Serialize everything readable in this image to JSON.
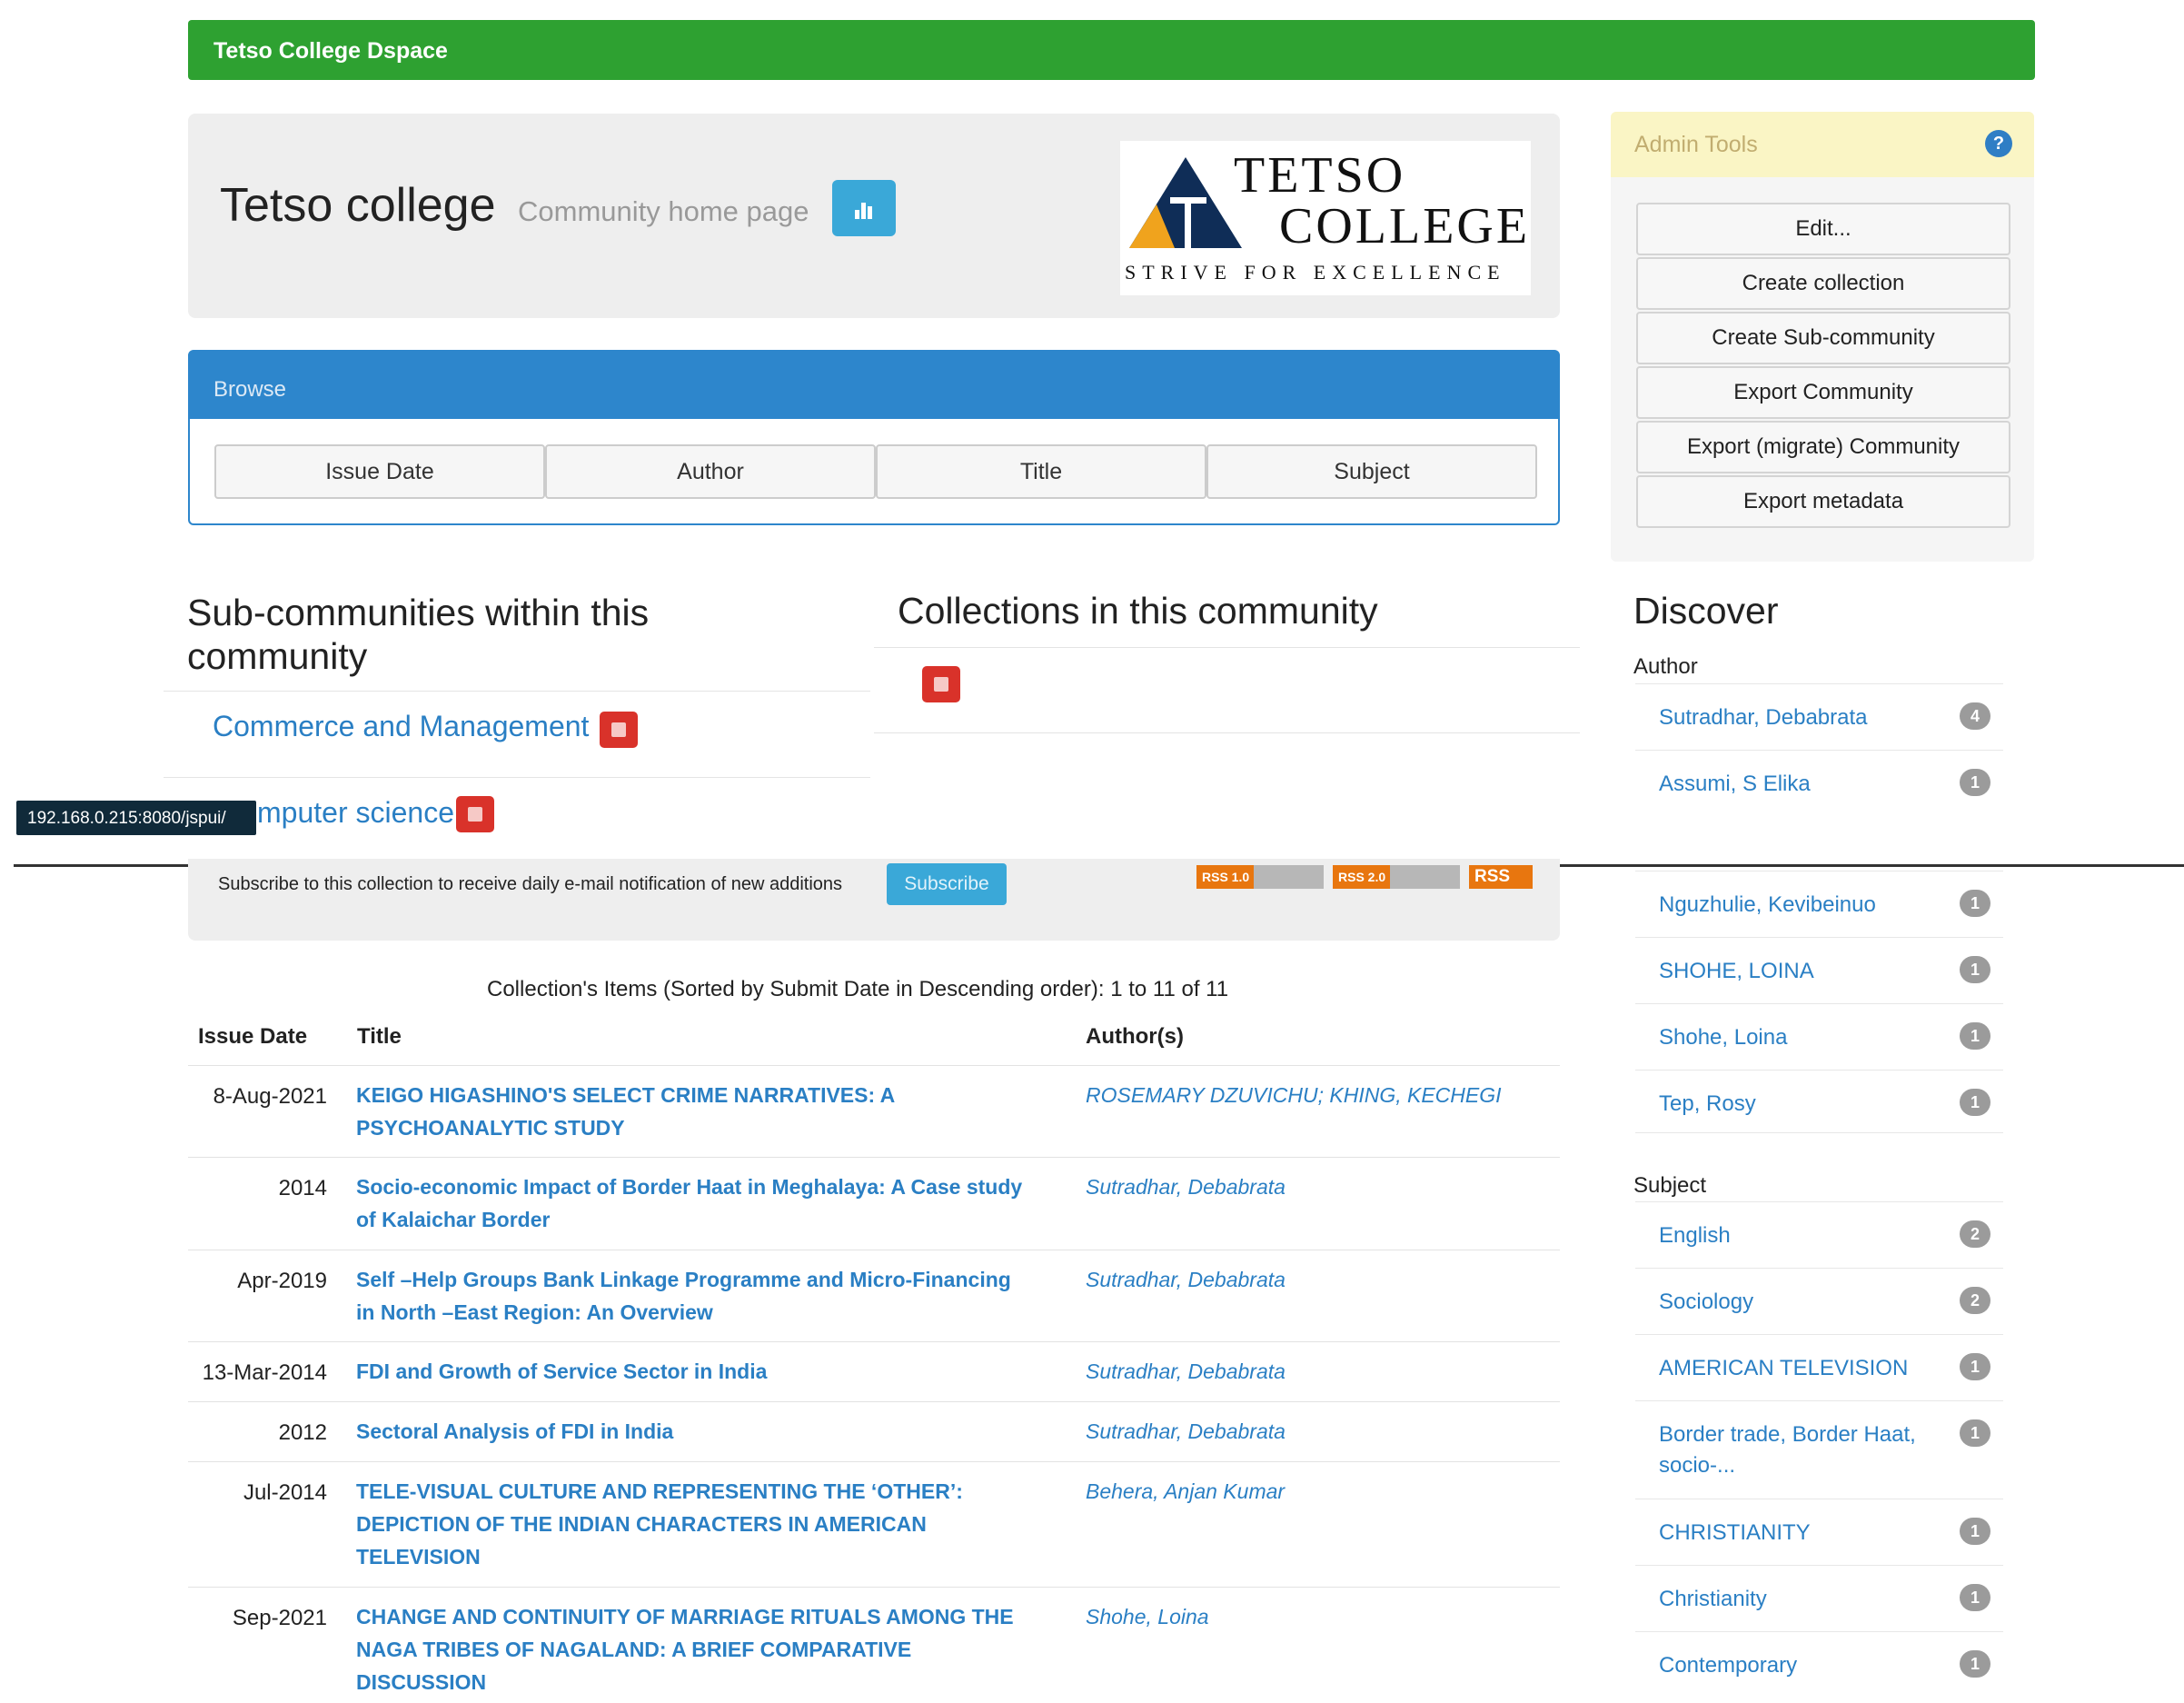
{
  "site": {
    "brand": "Tetso College Dspace"
  },
  "header": {
    "title": "Tetso college",
    "subtitle": "Community home page",
    "logo_name": "TETSO",
    "logo_name2": "COLLEGE",
    "logo_tagline": "STRIVE FOR EXCELLENCE"
  },
  "browse": {
    "label": "Browse",
    "buttons": [
      "Issue Date",
      "Author",
      "Title",
      "Subject"
    ]
  },
  "admin": {
    "label": "Admin Tools",
    "buttons": [
      "Edit...",
      "Create collection",
      "Create Sub-community",
      "Export Community",
      "Export (migrate) Community",
      "Export metadata"
    ]
  },
  "subcommunities": {
    "heading_line1": "Sub-communities within this",
    "heading_line2": "community",
    "items": [
      "Commerce and Management",
      "mputer science"
    ]
  },
  "collections": {
    "heading": "Collections in this community"
  },
  "status_tooltip": "192.168.0.215:8080/jspui/",
  "subscribe": {
    "text": "Subscribe to this collection to receive daily e-mail notification of new additions",
    "button": "Subscribe",
    "rss1": "RSS 1.0",
    "rss2": "RSS 2.0",
    "rss3": "RSS"
  },
  "items": {
    "caption": "Collection's Items (Sorted by Submit Date in Descending order): 1 to 11 of 11",
    "headers": [
      "Issue Date",
      "Title",
      "Author(s)"
    ],
    "rows": [
      {
        "date": "8-Aug-2021",
        "title": "KEIGO HIGASHINO'S SELECT CRIME NARRATIVES: A PSYCHOANALYTIC STUDY",
        "author": "ROSEMARY DZUVICHU; KHING, KECHEGI"
      },
      {
        "date": "2014",
        "title": "Socio-economic Impact of Border Haat in Meghalaya: A Case study of Kalaichar Border",
        "author": "Sutradhar, Debabrata"
      },
      {
        "date": "Apr-2019",
        "title": "Self –Help Groups Bank Linkage Programme and Micro-Financing in North –East Region: An Overview",
        "author": "Sutradhar, Debabrata"
      },
      {
        "date": "13-Mar-2014",
        "title": "FDI and Growth of Service Sector in India",
        "author": "Sutradhar, Debabrata"
      },
      {
        "date": "2012",
        "title": "Sectoral Analysis of FDI in India",
        "author": "Sutradhar, Debabrata"
      },
      {
        "date": "Jul-2014",
        "title": "TELE-VISUAL CULTURE AND REPRESENTING THE ‘OTHER’: DEPICTION OF THE INDIAN CHARACTERS IN AMERICAN TELEVISION",
        "author": "Behera, Anjan Kumar"
      },
      {
        "date": "Sep-2021",
        "title": "CHANGE AND CONTINUITY OF MARRIAGE RITUALS AMONG THE NAGA TRIBES OF NAGALAND: A BRIEF COMPARATIVE DISCUSSION",
        "author": "Shohe, Loina"
      }
    ]
  },
  "discover": {
    "heading": "Discover",
    "author_label": "Author",
    "authors": [
      {
        "name": "Sutradhar, Debabrata",
        "count": "4"
      },
      {
        "name": "Assumi, S Elika",
        "count": "1"
      },
      {
        "name": "Nguzhulie, Kevibeinuo",
        "count": "1"
      },
      {
        "name": "SHOHE, LOINA",
        "count": "1"
      },
      {
        "name": "Shohe, Loina",
        "count": "1"
      },
      {
        "name": "Tep, Rosy",
        "count": "1"
      }
    ],
    "subject_label": "Subject",
    "subjects": [
      {
        "name": "English",
        "count": "2"
      },
      {
        "name": "Sociology",
        "count": "2"
      },
      {
        "name": "AMERICAN TELEVISION",
        "count": "1"
      },
      {
        "name": "Border trade, Border Haat, socio-...",
        "count": "1"
      },
      {
        "name": "CHRISTIANITY",
        "count": "1"
      },
      {
        "name": "Christianity",
        "count": "1"
      },
      {
        "name": "Contemporary",
        "count": "1"
      }
    ]
  }
}
